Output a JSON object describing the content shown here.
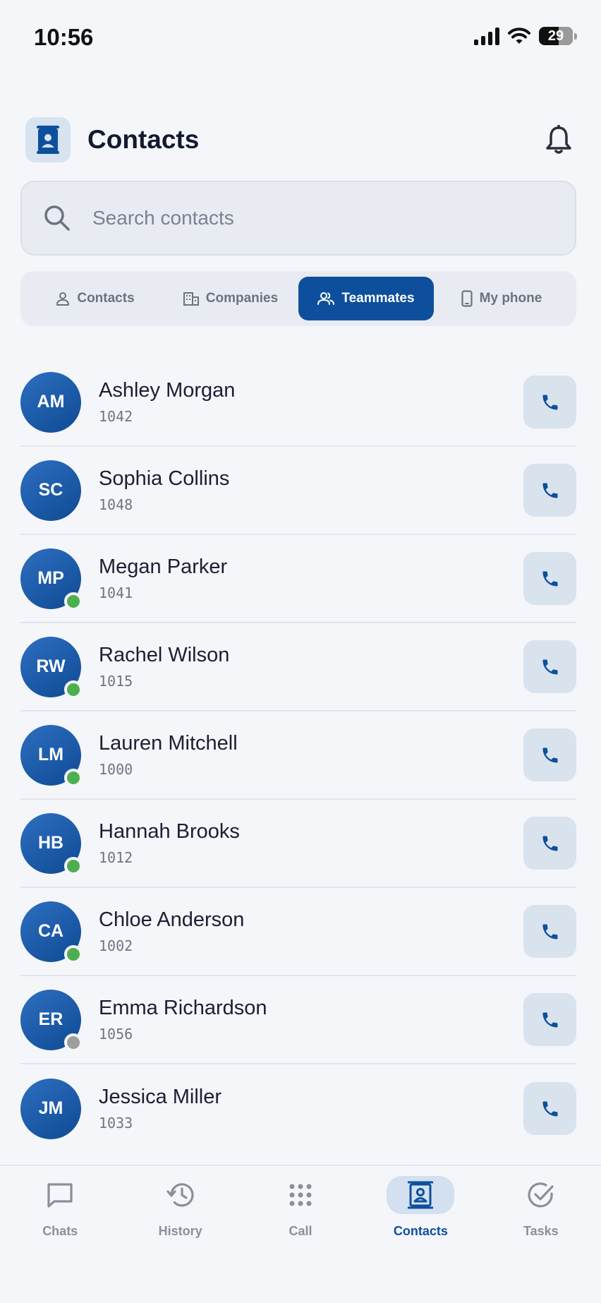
{
  "status": {
    "time": "10:56",
    "battery": "29"
  },
  "header": {
    "title": "Contacts"
  },
  "search": {
    "placeholder": "Search contacts"
  },
  "tabs": [
    {
      "label": "Contacts",
      "icon": "person-icon",
      "active": false
    },
    {
      "label": "Companies",
      "icon": "building-icon",
      "active": false
    },
    {
      "label": "Teammates",
      "icon": "people-icon",
      "active": true
    },
    {
      "label": "My phone",
      "icon": "phone-device-icon",
      "active": false
    }
  ],
  "contacts": [
    {
      "initials": "AM",
      "name": "Ashley Morgan",
      "ext": "1042",
      "presence": "none"
    },
    {
      "initials": "SC",
      "name": "Sophia Collins",
      "ext": "1048",
      "presence": "none"
    },
    {
      "initials": "MP",
      "name": "Megan Parker",
      "ext": "1041",
      "presence": "online"
    },
    {
      "initials": "RW",
      "name": "Rachel Wilson",
      "ext": "1015",
      "presence": "online"
    },
    {
      "initials": "LM",
      "name": "Lauren Mitchell",
      "ext": "1000",
      "presence": "online"
    },
    {
      "initials": "HB",
      "name": "Hannah Brooks",
      "ext": "1012",
      "presence": "online"
    },
    {
      "initials": "CA",
      "name": "Chloe Anderson",
      "ext": "1002",
      "presence": "online"
    },
    {
      "initials": "ER",
      "name": "Emma Richardson",
      "ext": "1056",
      "presence": "offline"
    },
    {
      "initials": "JM",
      "name": "Jessica Miller",
      "ext": "1033",
      "presence": "none"
    }
  ],
  "presence_colors": {
    "online": "#4caf50",
    "offline": "#9e9e9e"
  },
  "nav": [
    {
      "label": "Chats",
      "icon": "chat-icon",
      "active": false
    },
    {
      "label": "History",
      "icon": "history-icon",
      "active": false
    },
    {
      "label": "Call",
      "icon": "dialpad-icon",
      "active": false
    },
    {
      "label": "Contacts",
      "icon": "contacts-icon",
      "active": true
    },
    {
      "label": "Tasks",
      "icon": "check-circle-icon",
      "active": false
    }
  ],
  "colors": {
    "accent": "#0d4f9c",
    "background": "#f4f6fa"
  }
}
